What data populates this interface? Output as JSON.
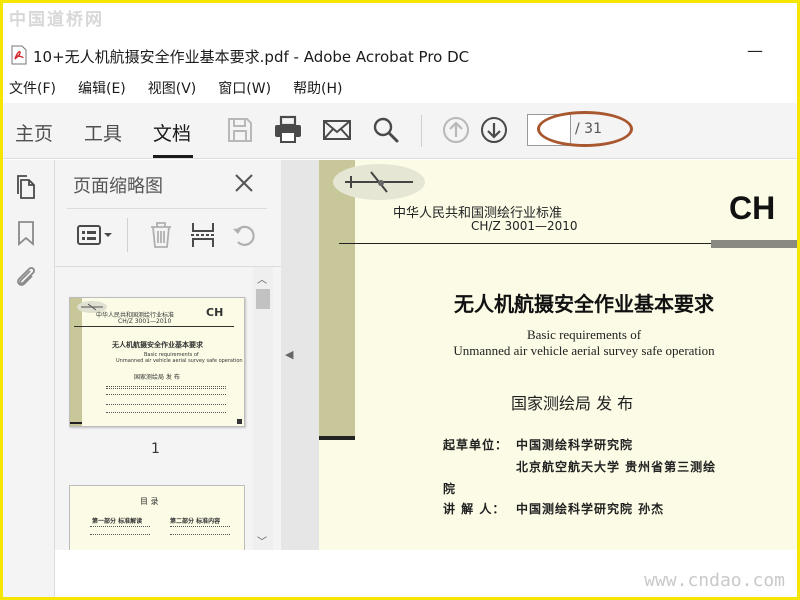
{
  "watermark": {
    "top": "中国道桥网",
    "bottom": "www.cndao.com"
  },
  "window": {
    "title": "10+无人机航摄安全作业基本要求.pdf - Adobe Acrobat Pro DC",
    "minimize": "—"
  },
  "menu": [
    "文件(F)",
    "编辑(E)",
    "视图(V)",
    "窗口(W)",
    "帮助(H)"
  ],
  "tabs": [
    {
      "label": "主页",
      "active": false
    },
    {
      "label": "工具",
      "active": false
    },
    {
      "label": "文档",
      "active": true
    }
  ],
  "toolbar": {
    "icons": [
      "save-icon",
      "print-icon",
      "email-icon",
      "search-icon",
      "page-up-icon",
      "page-down-icon"
    ],
    "page_current": "",
    "page_total": "/ 31",
    "highlight_color": "#a8572e"
  },
  "panel": {
    "title": "页面缩略图",
    "tools": [
      "options-menu-icon",
      "delete-icon",
      "extract-icon",
      "rotate-icon"
    ],
    "thumbnails": [
      {
        "page_number": "1",
        "lines": [
          "中华人民共和国测绘行业标准",
          "CH/Z 3001—2010",
          "CH",
          "无人机航摄安全作业基本要求",
          "Basic requirements of",
          "Unmanned air vehicle aerial survey safe operation",
          "国家测绘局   发 布"
        ]
      },
      {
        "page_number": "",
        "lines": [
          "目    录",
          "第一部分  标准解读",
          "第二部分  标准内容"
        ]
      }
    ]
  },
  "document": {
    "agency": "中华人民共和国测绘行业标准",
    "code": "CH/Z 3001—2010",
    "series": "CH",
    "title_cn": "无人机航摄安全作业基本要求",
    "title_en_1": "Basic requirements of",
    "title_en_2": "Unmanned air vehicle aerial survey safe operation",
    "publisher": "国家测绘局    发 布",
    "drafting_label": "起草单位：",
    "drafting_1": "中国测绘科学研究院",
    "drafting_2": "北京航空航天大学    贵州省第三测绘",
    "drafting_3": "院",
    "speaker_label": "讲 解 人：",
    "speaker": "中国测绘科学研究院      孙杰",
    "band_color": "#c8c79a",
    "paper_color": "#fbfbe6"
  }
}
